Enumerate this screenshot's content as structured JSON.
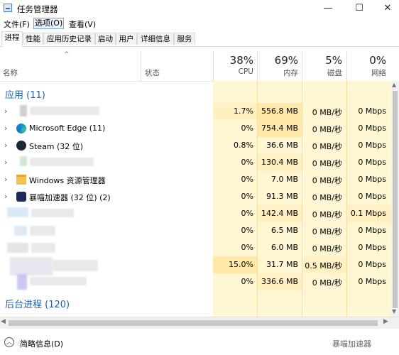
{
  "window": {
    "title": "任务管理器",
    "minimize": "—",
    "maximize": "☐",
    "close": "✕"
  },
  "menu": [
    "文件(F)",
    "选项(O)",
    "查看(V)"
  ],
  "tabs": [
    "进程",
    "性能",
    "应用历史记录",
    "启动",
    "用户",
    "详细信息",
    "服务"
  ],
  "header": {
    "name": "名称",
    "status": "状态",
    "cpu_pct": "38%",
    "cpu_label": "CPU",
    "mem_pct": "69%",
    "mem_label": "内存",
    "disk_pct": "5%",
    "disk_label": "磁盘",
    "net_pct": "0%",
    "net_label": "网络"
  },
  "sections": {
    "apps": "应用 (11)",
    "background": "后台进程 (120)"
  },
  "rows": [
    {
      "name": "",
      "cpu": "1.7%",
      "mem": "556.8 MB",
      "disk": "0 MB/秒",
      "net": "0 Mbps",
      "icon": "blurred"
    },
    {
      "name": "Microsoft Edge (11)",
      "cpu": "0%",
      "mem": "754.4 MB",
      "disk": "0 MB/秒",
      "net": "0 Mbps",
      "icon": "edge-icon"
    },
    {
      "name": "Steam (32 位)",
      "cpu": "0.8%",
      "mem": "36.6 MB",
      "disk": "0 MB/秒",
      "net": "0 Mbps",
      "icon": "steam-icon"
    },
    {
      "name": "",
      "cpu": "0%",
      "mem": "130.4 MB",
      "disk": "0 MB/秒",
      "net": "0 Mbps",
      "icon": "blurred"
    },
    {
      "name": "Windows 资源管理器",
      "cpu": "0%",
      "mem": "7.0 MB",
      "disk": "0 MB/秒",
      "net": "0 Mbps",
      "icon": "folder-icon"
    },
    {
      "name": "暴喵加速器 (32 位) (2)",
      "cpu": "0%",
      "mem": "91.3 MB",
      "disk": "0 MB/秒",
      "net": "0 Mbps",
      "icon": "accelerator-icon"
    },
    {
      "name": "",
      "cpu": "0%",
      "mem": "142.4 MB",
      "disk": "0 MB/秒",
      "net": "0.1 Mbps",
      "icon": "blurred"
    },
    {
      "name": "",
      "cpu": "0%",
      "mem": "6.5 MB",
      "disk": "0 MB/秒",
      "net": "0 Mbps",
      "icon": "blurred"
    },
    {
      "name": "",
      "cpu": "0%",
      "mem": "6.0 MB",
      "disk": "0 MB/秒",
      "net": "0 Mbps",
      "icon": "blurred"
    },
    {
      "name": "",
      "cpu": "15.0%",
      "mem": "31.7 MB",
      "disk": "0.5 MB/秒",
      "net": "0 Mbps",
      "icon": "blurred"
    },
    {
      "name": "",
      "cpu": "0%",
      "mem": "336.6 MB",
      "disk": "0 MB/秒",
      "net": "0 Mbps",
      "icon": "blurred"
    }
  ],
  "footer": {
    "fewer_details": "简略信息(D)",
    "watermark": "暴喵加速器"
  },
  "colors": {
    "accent": "#1f5fa8",
    "cell_bg": "#fff6d4",
    "cell_hot": "#ffe8a8",
    "cell_warm": "#fff0c2"
  }
}
